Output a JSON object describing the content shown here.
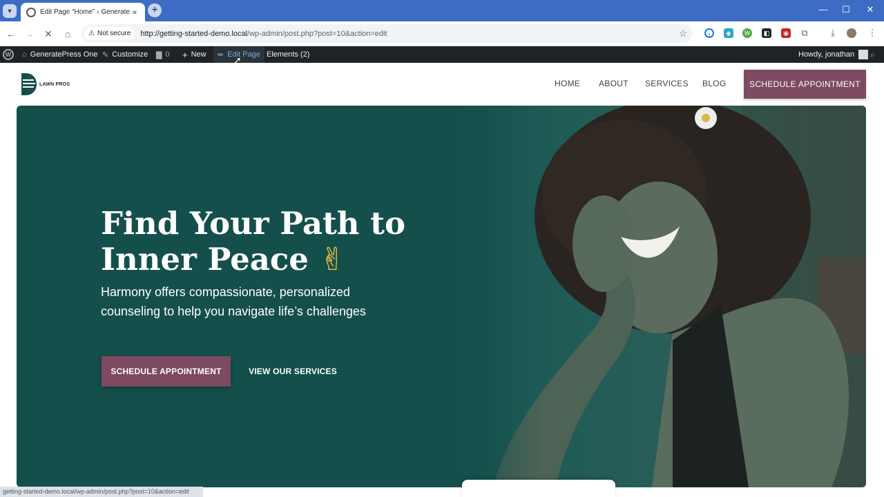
{
  "browser": {
    "tab_title": "Edit Page “Home” ‹ GeneratePr",
    "tab_close": "×",
    "new_tab": "+",
    "menu_glyph": "▾",
    "window_minimize": "—",
    "window_maximize": "☐",
    "window_close": "✕",
    "security_label": "Not secure",
    "url_host": "http://getting-started-demo.local",
    "url_path": "/wp-admin/post.php?post=10&action=edit",
    "status_text": "getting-started-demo.local/wp-admin/post.php?post=10&action=edit"
  },
  "admin_bar": {
    "site_name": "GeneratePress One",
    "customize": "Customize",
    "comments_count": "0",
    "new": "New",
    "edit_page": "Edit Page",
    "elements": "Elements (2)",
    "greeting": "Howdy, jonathan"
  },
  "site": {
    "logo_text": "LAWN PROS",
    "menu": [
      {
        "label": "HOME"
      },
      {
        "label": "ABOUT"
      },
      {
        "label": "SERVICES"
      },
      {
        "label": "BLOG"
      }
    ],
    "header_cta": "SCHEDULE APPOINTMENT"
  },
  "hero": {
    "title_line1": "Find Your Path to",
    "title_line2": "Inner Peace",
    "title_emoji": "✌",
    "subtitle": "Harmony offers compassionate, personalized counseling to help you navigate life’s challenges",
    "primary_button": "SCHEDULE APPOINTMENT",
    "secondary_button": "VIEW OUR SERVICES"
  },
  "colors": {
    "hero_bg": "#144f4c",
    "accent": "#7d4a62",
    "tab_strip": "#3d6cc4",
    "admin_bar": "#1d2327"
  }
}
